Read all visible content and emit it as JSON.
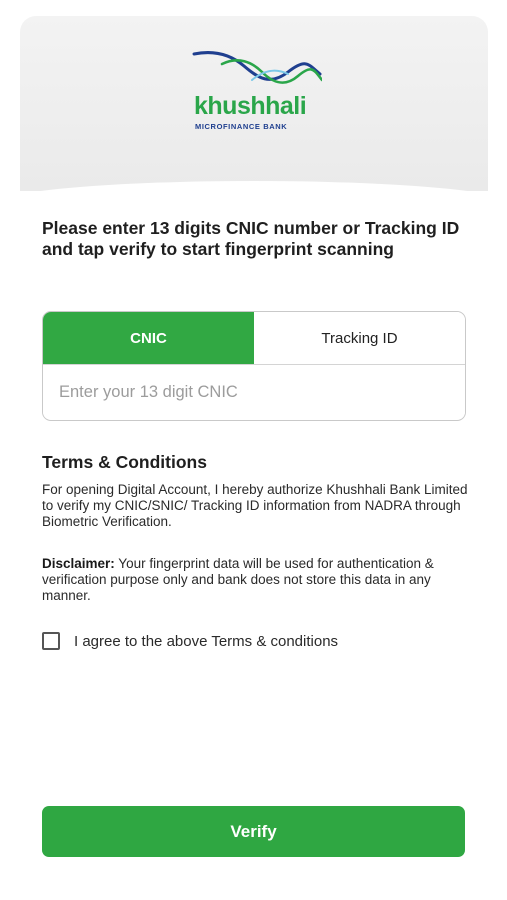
{
  "brand": {
    "name": "khushhali",
    "tagline": "MICROFINANCE BANK",
    "color_green": "#2aa64a",
    "color_blue": "#1f3f8f"
  },
  "instruction": "Please enter 13 digits CNIC number or Tracking ID and tap verify to start fingerprint scanning",
  "tabs": [
    {
      "label": "CNIC",
      "active": true
    },
    {
      "label": "Tracking ID",
      "active": false
    }
  ],
  "cnic_input": {
    "value": "",
    "placeholder": "Enter your 13 digit CNIC"
  },
  "terms": {
    "title": "Terms & Conditions",
    "body": "For opening Digital Account, I hereby authorize Khushhali Bank Limited to verify my CNIC/SNIC/ Tracking ID information from NADRA through Biometric Verification.",
    "disclaimer_label": "Disclaimer:",
    "disclaimer_text": " Your fingerprint data will be used for authentication & verification purpose only and bank does not store this data in any manner."
  },
  "agree": {
    "label": "I agree to the above Terms & conditions",
    "checked": false
  },
  "verify_button": {
    "label": "Verify"
  },
  "colors": {
    "accent": "#31a843"
  }
}
